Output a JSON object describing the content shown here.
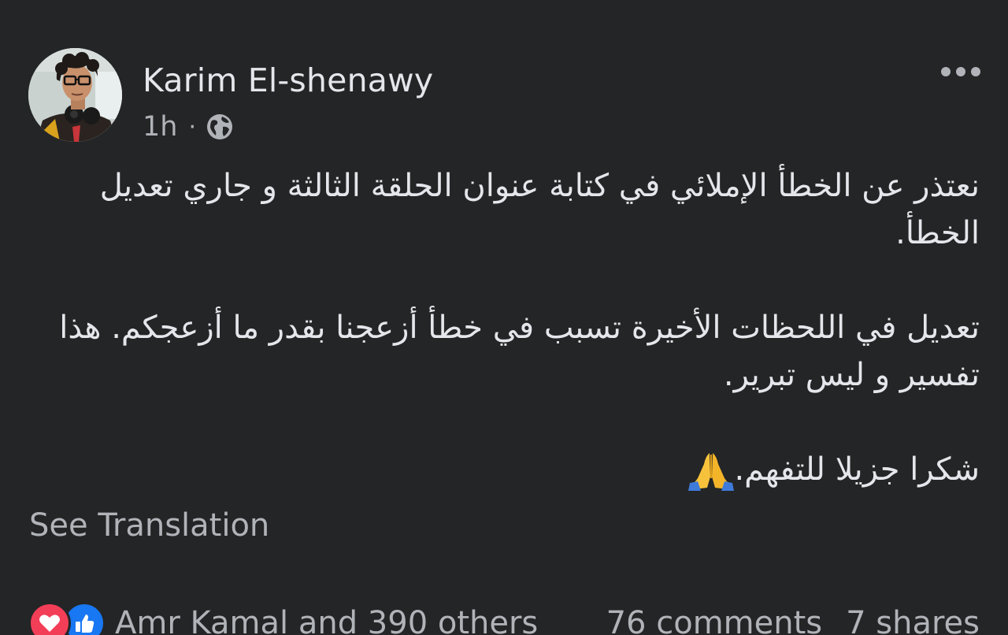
{
  "post": {
    "author": "Karim El-shenawy",
    "time": "1h",
    "separator": "·",
    "privacy_icon": "globe-icon",
    "more_icon": "more-horizontal-icon",
    "paragraphs": [
      "نعتذر عن الخطأ الإملائي في كتابة عنوان الحلقة الثالثة و جاري تعديل الخطأ.",
      "تعديل في اللحظات الأخيرة تسبب في خطأ أزعجنا بقدر ما أزعجكم. هذا تفسير و ليس تبرير.",
      "شكرا جزيلا للتفهم."
    ],
    "emoji": "folded-hands",
    "see_translation": "See Translation"
  },
  "footer": {
    "reaction_icons": [
      "love-icon",
      "like-icon"
    ],
    "reactions_text": "Amr Kamal and 390 others",
    "comments": "76 comments",
    "shares": "7 shares"
  },
  "colors": {
    "background": "#242526",
    "primary_text": "#e4e6eb",
    "secondary_text": "#b0b3b8",
    "love": "#f33e58",
    "like": "#1877f2"
  }
}
